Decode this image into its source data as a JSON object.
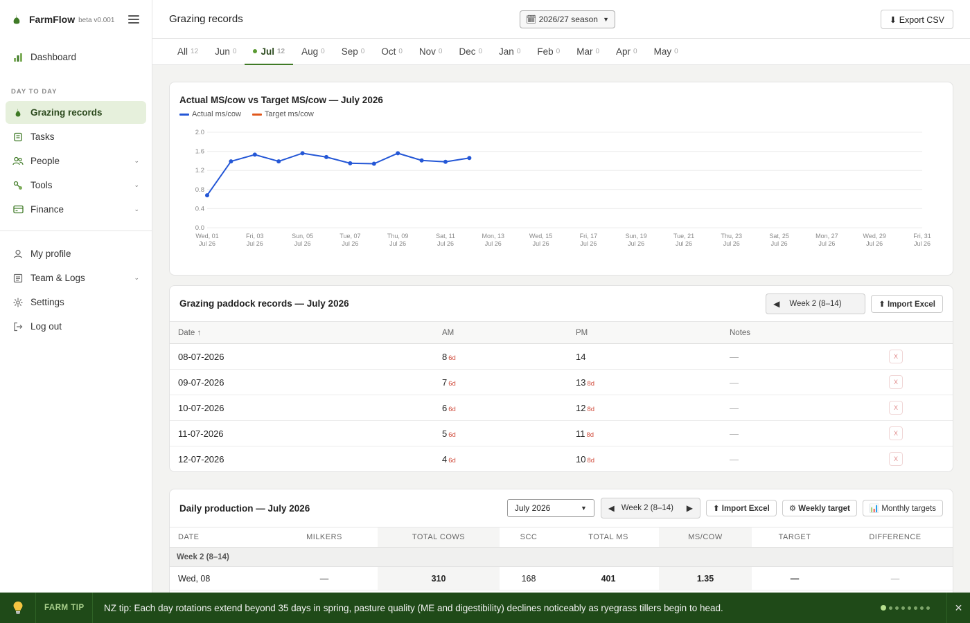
{
  "brand": {
    "name": "FarmFlow",
    "version": "beta v0.001"
  },
  "sidebar": {
    "items_top": [
      {
        "label": "Dashboard",
        "icon": "bar-chart-icon"
      }
    ],
    "section_label": "DAY TO DAY",
    "items_day": [
      {
        "label": "Grazing records",
        "icon": "leaf-icon",
        "active": true
      },
      {
        "label": "Tasks",
        "icon": "clipboard-icon"
      },
      {
        "label": "People",
        "icon": "people-icon",
        "expandable": true
      },
      {
        "label": "Tools",
        "icon": "tools-icon",
        "expandable": true
      },
      {
        "label": "Finance",
        "icon": "wallet-icon",
        "expandable": true
      }
    ],
    "items_bottom": [
      {
        "label": "My profile",
        "icon": "user-icon"
      },
      {
        "label": "Team & Logs",
        "icon": "log-icon",
        "expandable": true
      },
      {
        "label": "Settings",
        "icon": "gear-icon"
      },
      {
        "label": "Log out",
        "icon": "logout-icon"
      }
    ]
  },
  "header": {
    "title": "Grazing records",
    "season": "🗓 2026/27 season",
    "export_label": "⬇ Export CSV"
  },
  "tabs": [
    {
      "label": "All",
      "count": "12"
    },
    {
      "label": "Jun",
      "count": "0"
    },
    {
      "label": "Jul",
      "count": "12",
      "active": true
    },
    {
      "label": "Aug",
      "count": "0"
    },
    {
      "label": "Sep",
      "count": "0"
    },
    {
      "label": "Oct",
      "count": "0"
    },
    {
      "label": "Nov",
      "count": "0"
    },
    {
      "label": "Dec",
      "count": "0"
    },
    {
      "label": "Jan",
      "count": "0"
    },
    {
      "label": "Feb",
      "count": "0"
    },
    {
      "label": "Mar",
      "count": "0"
    },
    {
      "label": "Apr",
      "count": "0"
    },
    {
      "label": "May",
      "count": "0"
    }
  ],
  "chart_data": {
    "type": "line",
    "title": "Actual MS/cow vs Target MS/cow — July 2026",
    "legend": "top-left",
    "ylim": [
      0,
      2.0
    ],
    "y_ticks": [
      "2.0",
      "1.6",
      "1.2",
      "0.8",
      "0.4",
      "0.0"
    ],
    "x_ticks": [
      [
        "Wed, 01",
        "Jul 26"
      ],
      [
        "Fri, 03",
        "Jul 26"
      ],
      [
        "Sun, 05",
        "Jul 26"
      ],
      [
        "Tue, 07",
        "Jul 26"
      ],
      [
        "Thu, 09",
        "Jul 26"
      ],
      [
        "Sat, 11",
        "Jul 26"
      ],
      [
        "Mon, 13",
        "Jul 26"
      ],
      [
        "Wed, 15",
        "Jul 26"
      ],
      [
        "Fri, 17",
        "Jul 26"
      ],
      [
        "Sun, 19",
        "Jul 26"
      ],
      [
        "Tue, 21",
        "Jul 26"
      ],
      [
        "Thu, 23",
        "Jul 26"
      ],
      [
        "Sat, 25",
        "Jul 26"
      ],
      [
        "Mon, 27",
        "Jul 26"
      ],
      [
        "Wed, 29",
        "Jul 26"
      ],
      [
        "Fri, 31",
        "Jul 26"
      ]
    ],
    "grid": true,
    "series": [
      {
        "name": "Actual ms/cow",
        "color": "#2457d6",
        "x": [
          "2026-07-01",
          "2026-07-02",
          "2026-07-03",
          "2026-07-04",
          "2026-07-05",
          "2026-07-06",
          "2026-07-07",
          "2026-07-08",
          "2026-07-09",
          "2026-07-10",
          "2026-07-11",
          "2026-07-12"
        ],
        "values": [
          0.68,
          1.39,
          1.53,
          1.39,
          1.56,
          1.48,
          1.35,
          1.34,
          1.56,
          1.41,
          1.38,
          1.46
        ]
      },
      {
        "name": "Target ms/cow",
        "color": "#e0581c",
        "x": [],
        "values": []
      }
    ]
  },
  "records": {
    "title": "Grazing paddock records — July 2026",
    "week_label": "Week 2 (8–14)",
    "import_label": "⬆ Import Excel",
    "columns": [
      "Date ↑",
      "AM",
      "PM",
      "Notes"
    ],
    "rows": [
      {
        "date": "08-07-2026",
        "am": "8",
        "am_sub": "6d",
        "pm": "14",
        "pm_sub": "",
        "notes": "—"
      },
      {
        "date": "09-07-2026",
        "am": "7",
        "am_sub": "6d",
        "pm": "13",
        "pm_sub": "8d",
        "notes": "—"
      },
      {
        "date": "10-07-2026",
        "am": "6",
        "am_sub": "6d",
        "pm": "12",
        "pm_sub": "8d",
        "notes": "—"
      },
      {
        "date": "11-07-2026",
        "am": "5",
        "am_sub": "6d",
        "pm": "11",
        "pm_sub": "8d",
        "notes": "—"
      },
      {
        "date": "12-07-2026",
        "am": "4",
        "am_sub": "6d",
        "pm": "10",
        "pm_sub": "8d",
        "notes": "—"
      }
    ],
    "delete_label": "X"
  },
  "production": {
    "title": "Daily production — July 2026",
    "month": "July 2026",
    "week_label": "Week 2 (8–14)",
    "import_label": "⬆ Import Excel",
    "weekly_label": "⚙ Weekly target",
    "monthly_label": "📊 Monthly targets",
    "columns": [
      "DATE",
      "MILKERS",
      "TOTAL COWS",
      "SCC",
      "TOTAL MS",
      "MS/COW",
      "TARGET",
      "DIFFERENCE"
    ],
    "group_label": "Week 2 (8–14)",
    "rows": [
      {
        "date": "Wed, 08",
        "milkers": "—",
        "total_cows": "310",
        "scc": "168",
        "total_ms": "401",
        "ms_cow": "1.35",
        "target": "—",
        "difference": "—"
      }
    ]
  },
  "tip": {
    "label": "FARM TIP",
    "text": "NZ tip: Each day rotations extend beyond 35 days in spring, pasture quality (ME and digestibility) declines noticeably as ryegrass tillers begin to head.",
    "dots_total": 8,
    "dots_active": 0,
    "close": "✕"
  },
  "colors": {
    "brand_green": "#3f7a26",
    "tip_bg": "#1f4a18",
    "active_nav_bg": "#e6f0dc",
    "alert_red": "#d04a3a"
  }
}
